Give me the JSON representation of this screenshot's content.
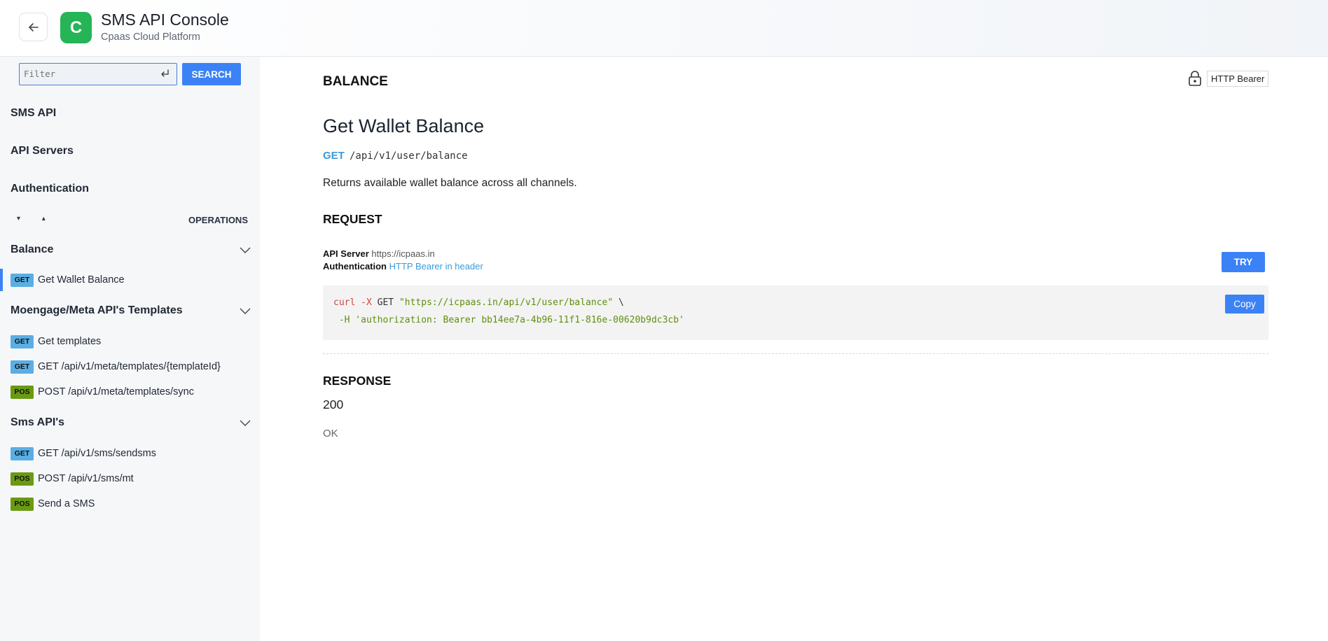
{
  "header": {
    "logo_letter": "C",
    "title": "SMS API Console",
    "subtitle": "Cpaas Cloud Platform"
  },
  "sidebar": {
    "filter_placeholder": "Filter",
    "search_label": "SEARCH",
    "nav": [
      "SMS API",
      "API Servers",
      "Authentication"
    ],
    "expand_arrows": "▾ ▴",
    "operations_label": "OPERATIONS",
    "groups": [
      {
        "title": "Balance",
        "items": [
          {
            "method": "GET",
            "label": "Get Wallet Balance",
            "active": true
          }
        ]
      },
      {
        "title": "Moengage/Meta API's Templates",
        "items": [
          {
            "method": "GET",
            "label": "Get templates"
          },
          {
            "method": "GET",
            "label": "GET /api/v1/meta/templates/{templateId}"
          },
          {
            "method": "POS",
            "label": "POST /api/v1/meta/templates/sync"
          }
        ]
      },
      {
        "title": "Sms API's",
        "items": [
          {
            "method": "GET",
            "label": "GET /api/v1/sms/sendsms"
          },
          {
            "method": "POS",
            "label": "POST /api/v1/sms/mt"
          },
          {
            "method": "POS",
            "label": "Send a SMS"
          }
        ]
      }
    ]
  },
  "main": {
    "tag_title": "BALANCE",
    "security_label": "HTTP Bearer",
    "operation_title": "Get Wallet Balance",
    "method": "GET",
    "path": "/api/v1/user/balance",
    "description": "Returns available wallet balance across all channels.",
    "request": {
      "heading": "REQUEST",
      "api_server_label": "API Server",
      "api_server_value": "https://icpaas.in",
      "auth_label": "Authentication",
      "auth_value": "HTTP Bearer in header",
      "try_label": "TRY",
      "curl_cmd": "curl",
      "curl_flag": "-X",
      "curl_method": "GET",
      "curl_url": "\"https://icpaas.in/api/v1/user/balance\"",
      "curl_cont": "\\",
      "curl_header": "-H 'authorization: Bearer bb14ee7a-4b96-11f1-816e-00620b9dc3cb'",
      "copy_label": "Copy"
    },
    "response": {
      "heading": "RESPONSE",
      "status_code": "200",
      "status_text": "OK"
    }
  },
  "colors": {
    "accent": "#3b82f6",
    "get_badge": "#5aaee3",
    "post_badge": "#6a9a12",
    "logo": "#25b456"
  }
}
